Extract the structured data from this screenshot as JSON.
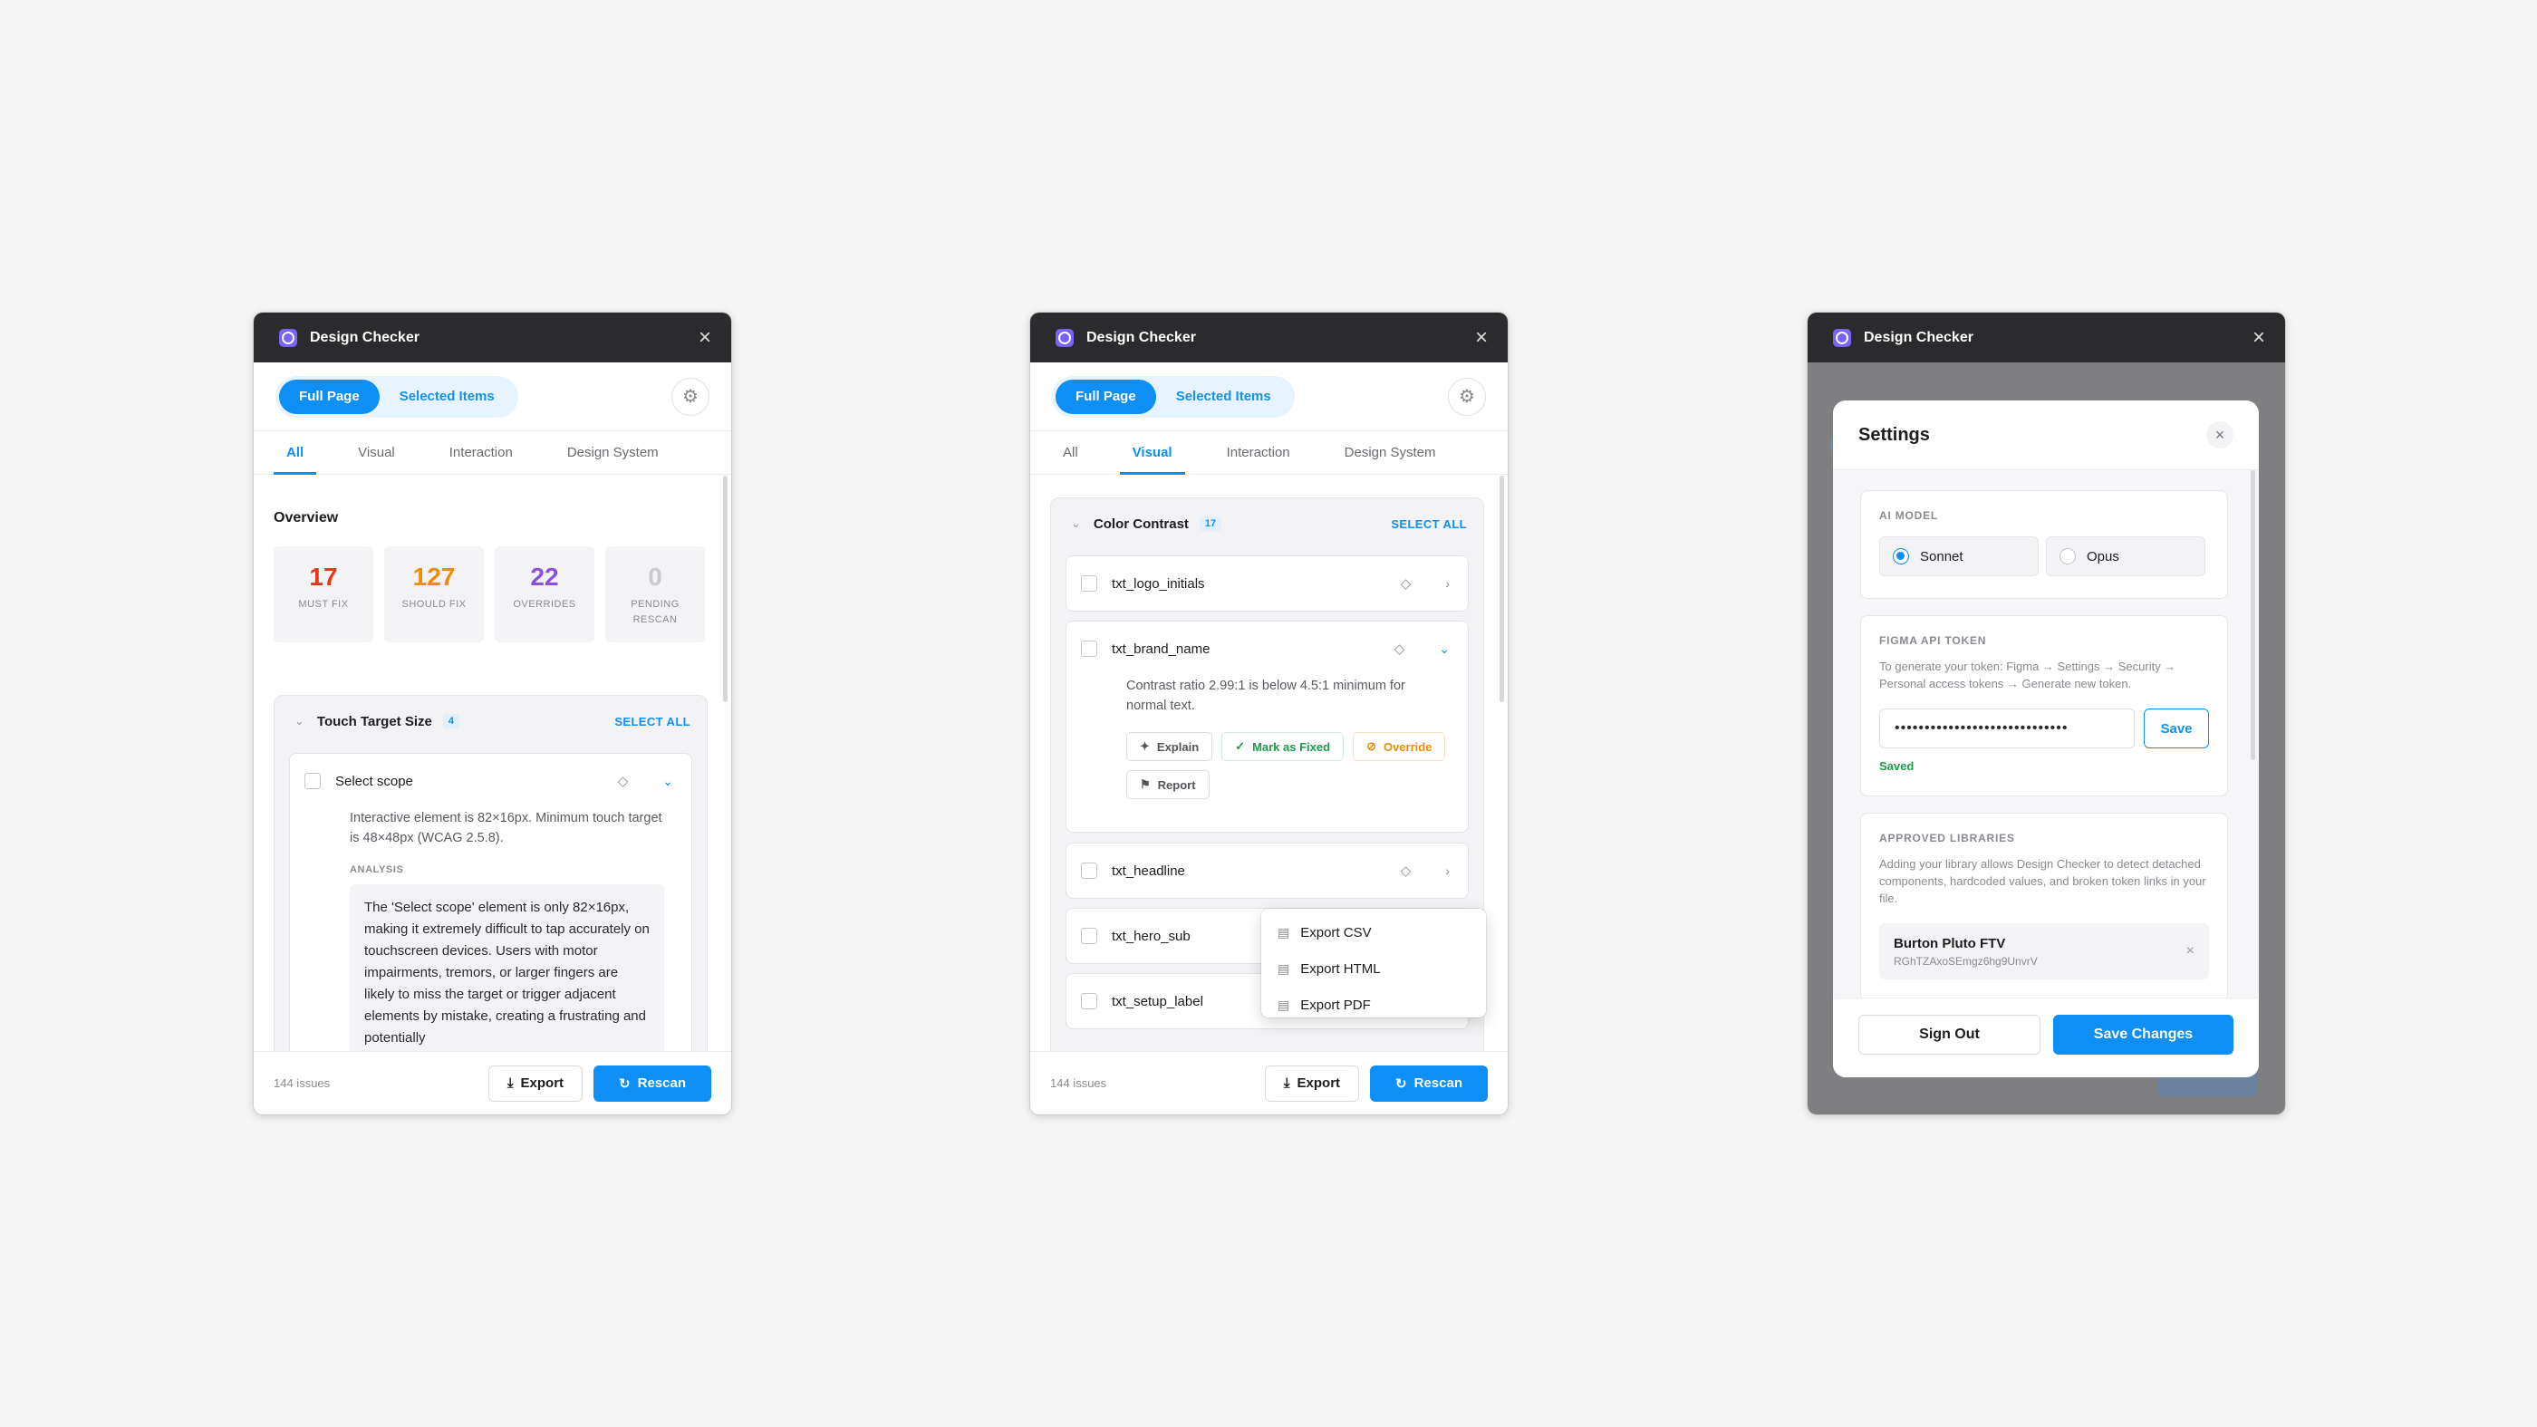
{
  "app": {
    "title": "Design Checker"
  },
  "scope": {
    "full_page": "Full Page",
    "selected_items": "Selected Items"
  },
  "tabs": {
    "all": "All",
    "visual": "Visual",
    "interaction": "Interaction",
    "design_system": "Design System"
  },
  "icons": {
    "logo": "design-checker-logo-icon",
    "close": "close-icon",
    "settings": "gear-icon",
    "export": "download-icon",
    "rescan": "refresh-icon",
    "component": "diamond-icon",
    "file": "file-icon"
  },
  "colors": {
    "accent": "#0d8ff5",
    "must_fix": "#e5381b",
    "should_fix": "#f08c00",
    "overrides": "#8b4fe8",
    "pending": "#c9c9ce",
    "success": "#1b9c4b",
    "titlebar": "#2b2b2d"
  },
  "footer": {
    "issues": "144 issues",
    "export": "Export",
    "rescan": "Rescan"
  },
  "panel1": {
    "overview_title": "Overview",
    "stats": [
      {
        "value": "17",
        "label": "MUST FIX"
      },
      {
        "value": "127",
        "label": "SHOULD FIX"
      },
      {
        "value": "22",
        "label": "OVERRIDES"
      },
      {
        "value": "0",
        "label": "PENDING RESCAN"
      }
    ],
    "group": {
      "name": "Touch Target Size",
      "count": "4",
      "select_all": "SELECT ALL"
    },
    "item": {
      "name": "Select scope",
      "description": "Interactive element is 82×16px. Minimum touch target is 48×48px (WCAG 2.5.8).",
      "analysis_label": "ANALYSIS",
      "analysis": "The 'Select scope' element is only 82×16px, making it extremely difficult to tap accurately on touchscreen devices. Users with motor impairments, tremors, or larger fingers are likely to miss the target or trigger adjacent elements by mistake, creating a frustrating and potentially"
    }
  },
  "panel2": {
    "group": {
      "name": "Color Contrast",
      "count": "17",
      "select_all": "SELECT ALL"
    },
    "items": [
      {
        "name": "txt_logo_initials"
      },
      {
        "name": "txt_brand_name",
        "description": "Contrast ratio 2.99:1 is below 4.5:1 minimum for normal text."
      },
      {
        "name": "txt_headline"
      },
      {
        "name": "txt_hero_sub"
      },
      {
        "name": "txt_setup_label"
      }
    ],
    "actions": {
      "explain": "Explain",
      "mark_fixed": "Mark as Fixed",
      "override": "Override",
      "report": "Report"
    },
    "export_menu": [
      "Export CSV",
      "Export HTML",
      "Export PDF"
    ]
  },
  "settings": {
    "title": "Settings",
    "ai_model": {
      "label": "AI MODEL",
      "options": [
        "Sonnet",
        "Opus"
      ],
      "selected": "Sonnet"
    },
    "figma_token": {
      "label": "FIGMA API TOKEN",
      "help": "To generate your token: Figma → Settings → Security → Personal access tokens → Generate new token.",
      "value": "•••••••••••••••••••••••••••••",
      "save": "Save",
      "status": "Saved"
    },
    "libraries": {
      "label": "APPROVED LIBRARIES",
      "help": "Adding your library allows Design Checker to detect detached components, hardcoded values, and broken token links in your file.",
      "items": [
        {
          "name": "Burton Pluto FTV",
          "key": "RGhTZAxoSEmgz6hg9UnvrV"
        }
      ]
    },
    "sign_out": "Sign Out",
    "save_changes": "Save Changes"
  }
}
